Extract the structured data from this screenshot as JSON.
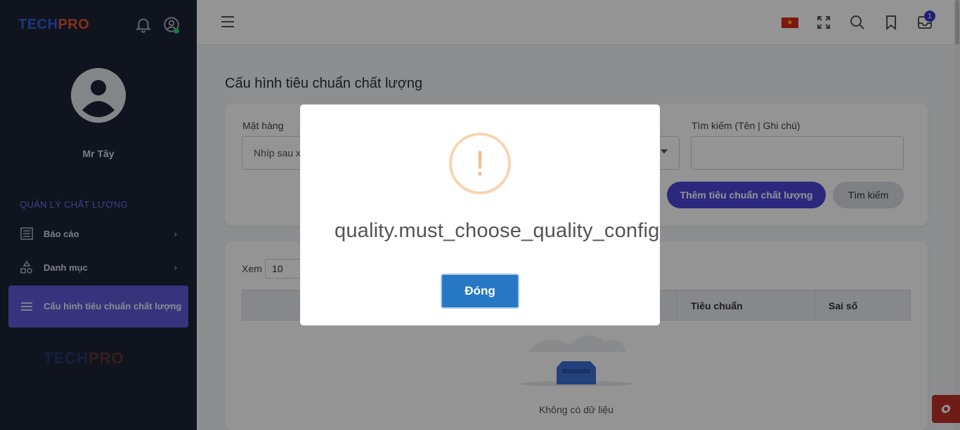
{
  "sidebar": {
    "logo_tech": "TECH",
    "logo_pro": "PRO",
    "user_name": "Mr Tây",
    "section_title": "QUẢN LÝ CHẤT LƯỢNG",
    "items": [
      {
        "label": "Báo cáo",
        "icon": "report-icon"
      },
      {
        "label": "Danh mục",
        "icon": "category-icon"
      },
      {
        "label": "Cấu hình tiêu chuẩn chất lượng",
        "icon": "menu-lines-icon",
        "active": true
      }
    ],
    "footer_logo_tech": "TECH",
    "footer_logo_pro": "PRO"
  },
  "header": {
    "notification_count": "1",
    "language_flag": "vietnam-flag"
  },
  "main": {
    "page_title": "Cấu hình tiêu chuẩn chất lượng",
    "filters": {
      "item_label": "Mặt hàng",
      "item_value": "Nhíp sau x",
      "search_label": "Tìm kiếm (Tên | Ghi chú)",
      "search_value": ""
    },
    "add_button": "Thêm tiêu chuẩn chất lượng",
    "search_button": "Tìm kiếm",
    "show_label": "Xem",
    "page_size": "10",
    "table_headers": [
      "Tiêu chuẩn",
      "Sai số"
    ],
    "empty_text": "Không có dữ liệu"
  },
  "modal": {
    "message": "quality.must_choose_quality_config",
    "icon_symbol": "!",
    "close_button": "Đóng"
  },
  "colors": {
    "sidebar_bg": "#1b2336",
    "accent": "#4b45d8",
    "modal_button": "#2778c4",
    "warning": "#f8bb86"
  }
}
